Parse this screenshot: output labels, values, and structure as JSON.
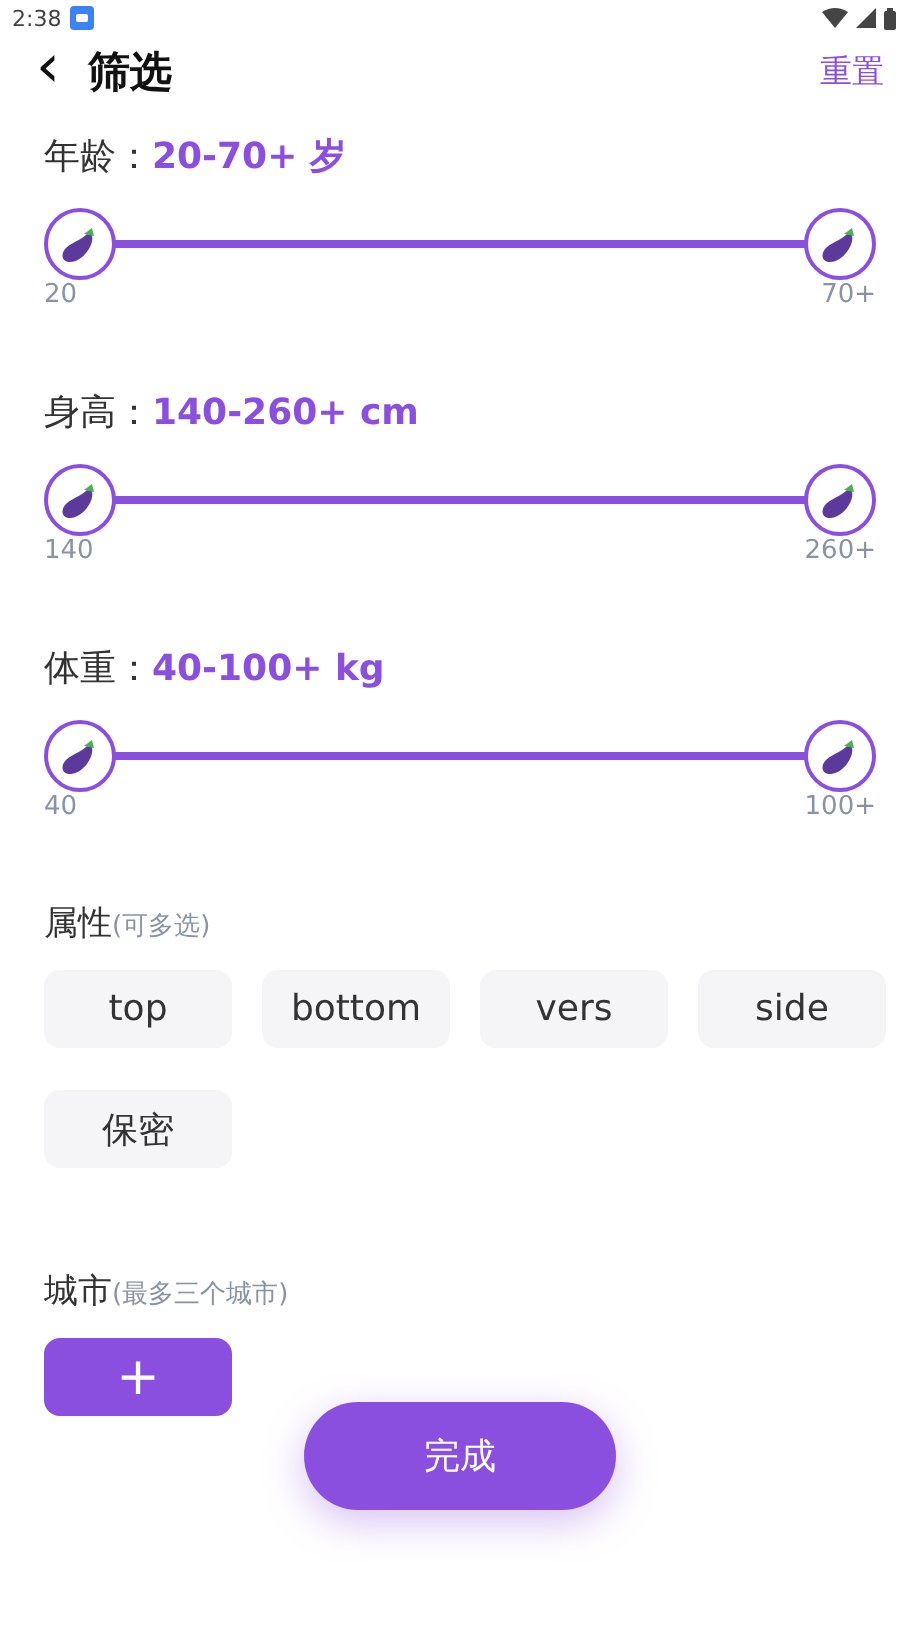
{
  "status_bar": {
    "time": "2:38"
  },
  "header": {
    "back": "‹",
    "title": "筛选",
    "action": "重置"
  },
  "ranges": [
    {
      "label": "年龄：",
      "value": "20-70+ 岁",
      "min_label": "20",
      "max_label": "70+",
      "thumbs": [
        {
          "level": 0
        },
        {
          "level": 1
        }
      ]
    },
    {
      "label": "身高：",
      "value": "140-260+ cm",
      "min_label": "140",
      "max_label": "260+",
      "thumbs": [
        {
          "level": 0
        },
        {
          "level": 1
        }
      ]
    },
    {
      "label": "体重：",
      "value": "40-100+ kg",
      "min_label": "40",
      "max_label": "100+",
      "thumbs": [
        {
          "level": 0
        },
        {
          "level": 1
        }
      ]
    }
  ],
  "attributes": {
    "title": "属性",
    "hint": "(可多选)",
    "options": [
      {
        "label": "top",
        "selected": false
      },
      {
        "label": "bottom",
        "selected": false
      },
      {
        "label": "vers",
        "selected": false
      },
      {
        "label": "side",
        "selected": false
      },
      {
        "label": "保密",
        "selected": false
      }
    ]
  },
  "city": {
    "title": "城市",
    "hint": "(最多三个城市)",
    "add": "+"
  },
  "done": "完成"
}
